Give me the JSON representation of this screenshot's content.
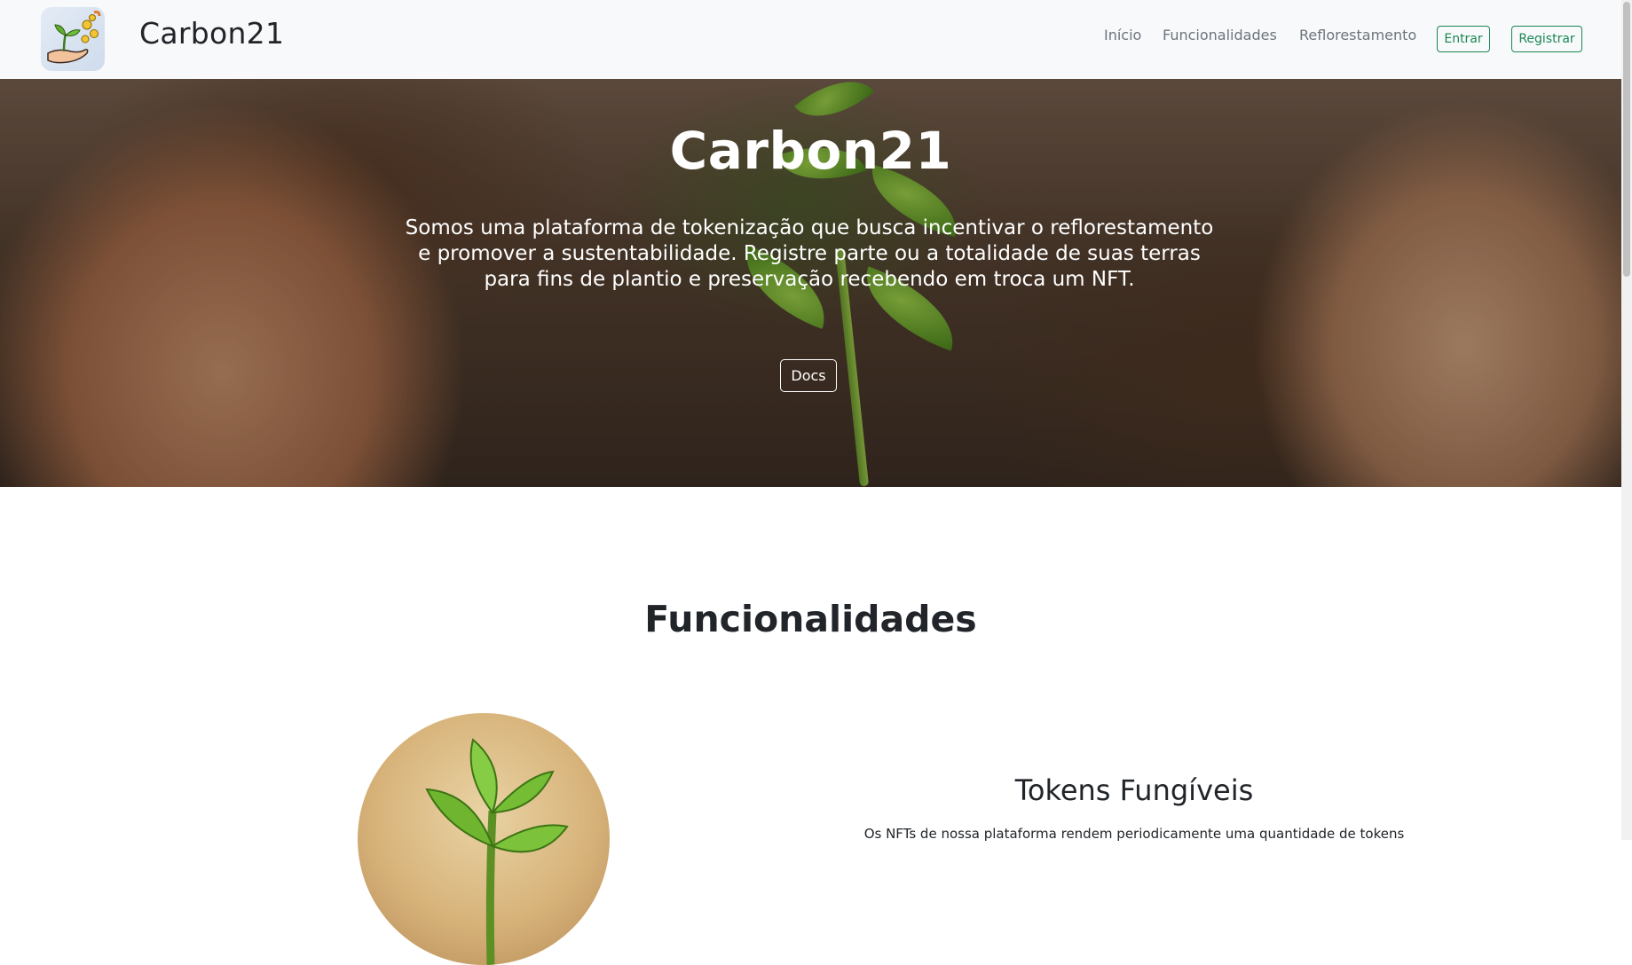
{
  "navbar": {
    "brand": "Carbon21",
    "links": [
      "Início",
      "Funcionalidades",
      "Reflorestamento"
    ],
    "login_label": "Entrar",
    "register_label": "Registrar"
  },
  "hero": {
    "title": "Carbon21",
    "description": "Somos uma plataforma de tokenização que busca incentivar o reflorestamento e promover a sustentabilidade. Registre parte ou a totalidade de suas terras para fins de plantio e preservação recebendo em troca um NFT.",
    "docs_label": "Docs"
  },
  "features": {
    "section_title": "Funcionalidades",
    "items": [
      {
        "title": "Tokens Fungíveis",
        "text": "Os NFTs de nossa plataforma rendem periodicamente uma quantidade de tokens"
      }
    ]
  },
  "colors": {
    "accent": "#198754",
    "navbar_bg": "#f8f9fa",
    "link_muted": "#6c757d",
    "text_dark": "#212529"
  }
}
